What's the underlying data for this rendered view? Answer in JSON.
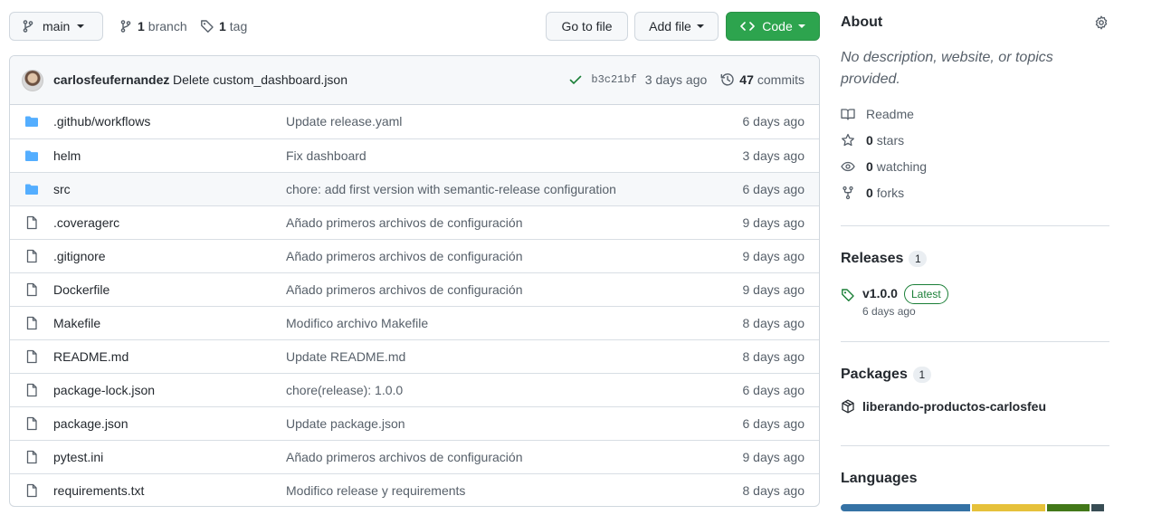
{
  "toolbar": {
    "branch_label": "main",
    "branches_count": "1",
    "branches_label": "branch",
    "tags_count": "1",
    "tags_label": "tag",
    "go_to_file": "Go to file",
    "add_file": "Add file",
    "code": "Code"
  },
  "commit": {
    "author": "carlosfeufernandez",
    "message": "Delete custom_dashboard.json",
    "sha": "b3c21bf",
    "ago": "3 days ago",
    "commits_count": "47",
    "commits_label": "commits"
  },
  "files": [
    {
      "type": "folder",
      "name": ".github/workflows",
      "message": "Update release.yaml",
      "age": "6 days ago"
    },
    {
      "type": "folder",
      "name": "helm",
      "message": "Fix dashboard",
      "age": "3 days ago"
    },
    {
      "type": "folder",
      "name": "src",
      "message": "chore: add first version with semantic-release configuration",
      "age": "6 days ago"
    },
    {
      "type": "file",
      "name": ".coveragerc",
      "message": "Añado primeros archivos de configuración",
      "age": "9 days ago"
    },
    {
      "type": "file",
      "name": ".gitignore",
      "message": "Añado primeros archivos de configuración",
      "age": "9 days ago"
    },
    {
      "type": "file",
      "name": "Dockerfile",
      "message": "Añado primeros archivos de configuración",
      "age": "9 days ago"
    },
    {
      "type": "file",
      "name": "Makefile",
      "message": "Modifico archivo Makefile",
      "age": "8 days ago"
    },
    {
      "type": "file",
      "name": "README.md",
      "message": "Update README.md",
      "age": "8 days ago"
    },
    {
      "type": "file",
      "name": "package-lock.json",
      "message": "chore(release): 1.0.0",
      "age": "6 days ago"
    },
    {
      "type": "file",
      "name": "package.json",
      "message": "Update package.json",
      "age": "6 days ago"
    },
    {
      "type": "file",
      "name": "pytest.ini",
      "message": "Añado primeros archivos de configuración",
      "age": "9 days ago"
    },
    {
      "type": "file",
      "name": "requirements.txt",
      "message": "Modifico release y requirements",
      "age": "8 days ago"
    }
  ],
  "about": {
    "title": "About",
    "description": "No description, website, or topics provided.",
    "readme": "Readme",
    "stars_count": "0",
    "stars_label": "stars",
    "watching_count": "0",
    "watching_label": "watching",
    "forks_count": "0",
    "forks_label": "forks"
  },
  "releases": {
    "title": "Releases",
    "count": "1",
    "version": "v1.0.0",
    "badge": "Latest",
    "date": "6 days ago"
  },
  "packages": {
    "title": "Packages",
    "count": "1",
    "name": "liberando-productos-carlosfeu"
  },
  "languages": {
    "title": "Languages",
    "bar": [
      {
        "color": "#3572A5",
        "share": 0.49
      },
      {
        "color": "#e6c13a",
        "share": 0.28
      },
      {
        "color": "#427819",
        "share": 0.16
      },
      {
        "color": "#384d54",
        "share": 0.05
      }
    ]
  },
  "colors": {
    "accent_green": "#2da44e",
    "folder_blue": "#54aeff",
    "latest_green": "#1a7f37"
  },
  "icons": {
    "folder": "folder-icon",
    "file": "file-icon"
  }
}
